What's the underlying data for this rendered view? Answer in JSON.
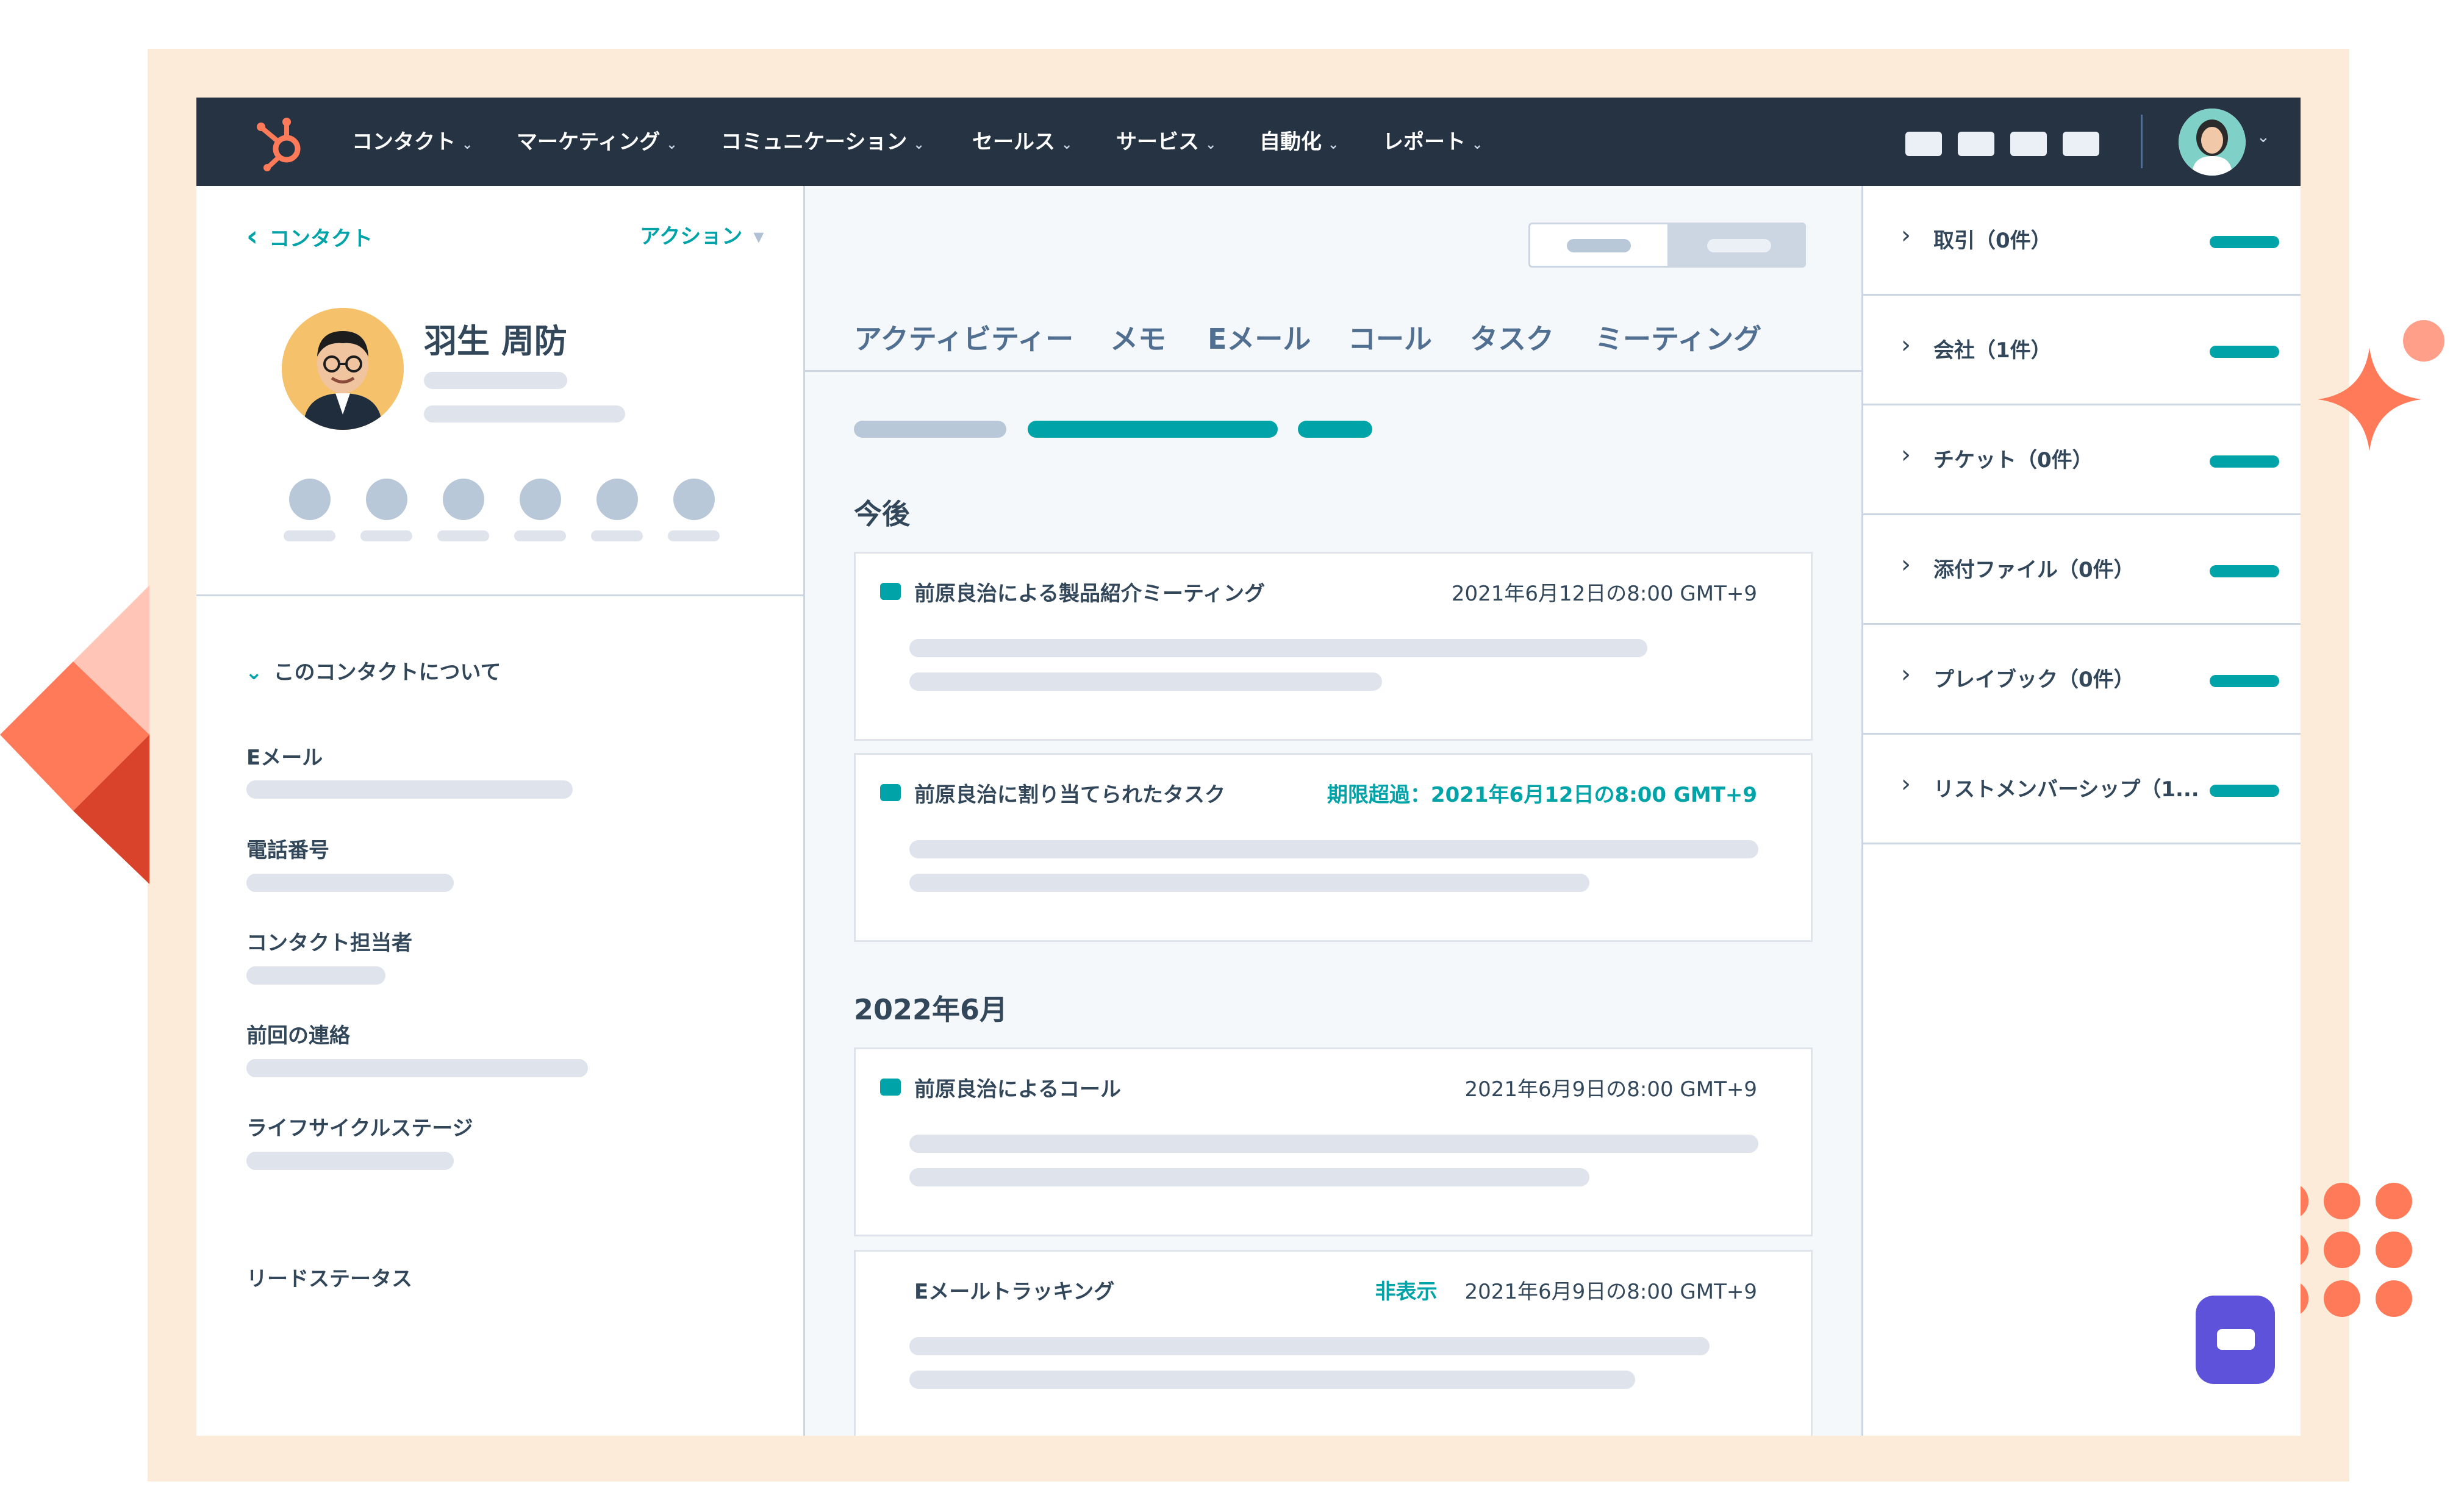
{
  "nav": {
    "items": [
      {
        "label": "コンタクト"
      },
      {
        "label": "マーケティング"
      },
      {
        "label": "コミュニケーション"
      },
      {
        "label": "セールス"
      },
      {
        "label": "サービス"
      },
      {
        "label": "自動化"
      },
      {
        "label": "レポート"
      }
    ],
    "chevron": "⌄"
  },
  "left": {
    "back_label": "コンタクト",
    "back_chevron": "‹",
    "action_label": "アクション",
    "action_caret": "▾",
    "contact_name": "羽生 周防",
    "about_label": "このコンタクトについて",
    "about_chevron": "⌄",
    "properties": [
      {
        "label": "Eメール"
      },
      {
        "label": "電話番号"
      },
      {
        "label": "コンタクト担当者"
      },
      {
        "label": "前回の連絡"
      },
      {
        "label": "ライフサイクルステージ"
      },
      {
        "label": "リードステータス"
      }
    ]
  },
  "middle": {
    "tabs": [
      {
        "label": "アクティビティー"
      },
      {
        "label": "メモ"
      },
      {
        "label": "Eメール"
      },
      {
        "label": "コール"
      },
      {
        "label": "タスク"
      },
      {
        "label": "ミーティング"
      }
    ],
    "upcoming_heading": "今後",
    "month_heading": "2022年6月",
    "cards": [
      {
        "title": "前原良治による製品紹介ミーティング",
        "flag": "",
        "date": "2021年6月12日の8:00 GMT+9"
      },
      {
        "title": "前原良治に割り当てられたタスク",
        "flag": "期限超過：",
        "date": "2021年6月12日の8:00 GMT+9"
      },
      {
        "title": "前原良治によるコール",
        "flag": "",
        "date": "2021年6月9日の8:00 GMT+9"
      },
      {
        "title": "Eメールトラッキング",
        "flag": "非表示",
        "date": "2021年6月9日の8:00 GMT+9"
      }
    ]
  },
  "right": {
    "chevron": "›",
    "items": [
      {
        "label": "取引（0件）"
      },
      {
        "label": "会社（1件）"
      },
      {
        "label": "チケット（0件）"
      },
      {
        "label": "添付ファイル（0件）"
      },
      {
        "label": "プレイブック（0件）"
      },
      {
        "label": "リストメンバーシップ（1..."
      }
    ]
  },
  "colors": {
    "nav_bg": "#253342",
    "accent": "#00a3a7",
    "frame": "#fdebd9",
    "decor": "#ff7a59",
    "chat": "#5d52d9"
  }
}
